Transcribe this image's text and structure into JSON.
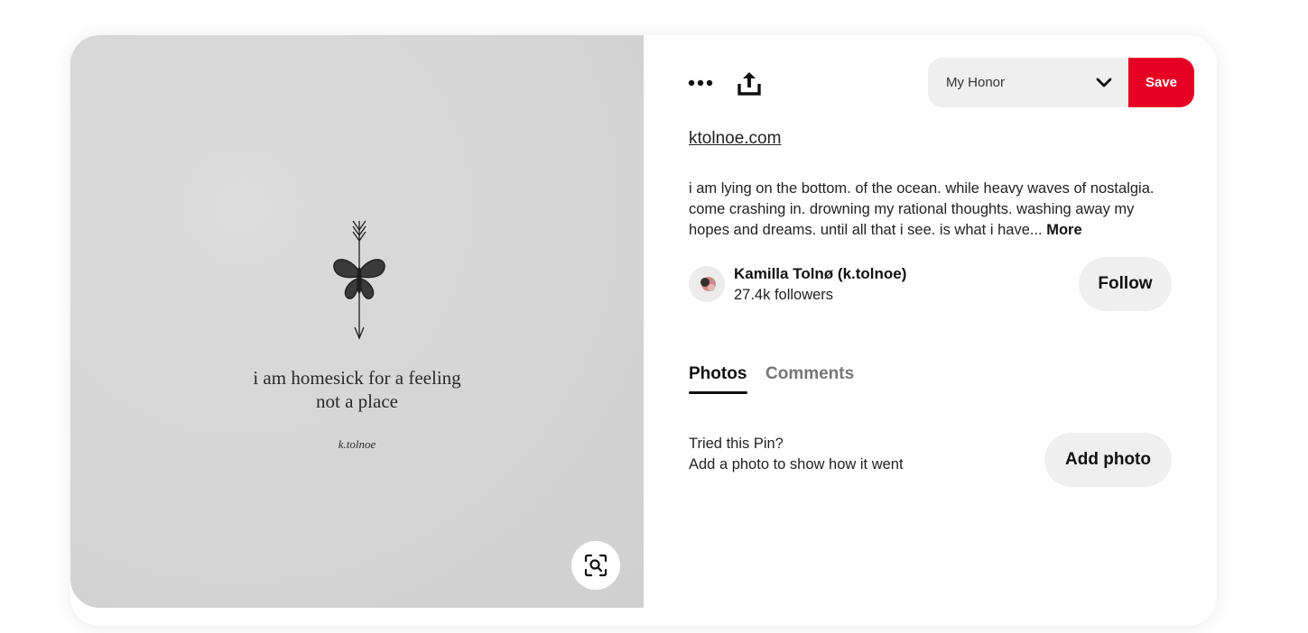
{
  "image": {
    "quote_line1": "i am homesick for a feeling",
    "quote_line2": "not a place",
    "signature": "k.tolnoe",
    "lens_icon": "visual-search-icon"
  },
  "toolbar": {
    "more_icon": "more-dots-icon",
    "share_icon": "share-upload-icon",
    "board_name": "My Honor",
    "board_chevron_icon": "chevron-down-icon",
    "save_label": "Save",
    "save_color": "#e60023"
  },
  "pin": {
    "source_link": "ktolnoe.com",
    "description": "i am lying on the bottom. of the ocean. while heavy waves of nostalgia. come crashing in. drowning my rational thoughts. washing away my hopes and dreams. until all that i see. is what i have...",
    "more_label": "More"
  },
  "creator": {
    "name": "Kamilla Tolnø (k.tolnoe)",
    "followers": "27.4k followers",
    "follow_label": "Follow"
  },
  "tabs": [
    {
      "label": "Photos",
      "active": true
    },
    {
      "label": "Comments",
      "active": false
    }
  ],
  "tried": {
    "title": "Tried this Pin?",
    "subtitle": "Add a photo to show how it went",
    "add_photo_label": "Add photo"
  }
}
